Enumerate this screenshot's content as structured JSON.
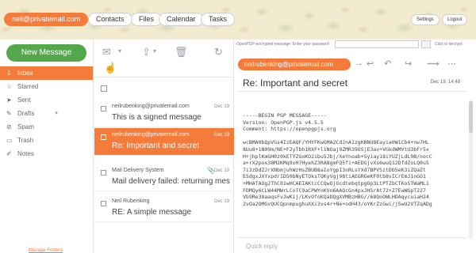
{
  "colors": {
    "accent": "#f47b3a",
    "new_message": "#52a84a"
  },
  "header": {
    "account": "neil@privatemail.com",
    "nav": [
      "Contacts",
      "Files",
      "Calendar",
      "Tasks"
    ],
    "settings": "Settings",
    "logout": "Logout"
  },
  "sidebar": {
    "new_message": "New Message",
    "folders": [
      {
        "label": "Inbox",
        "icon": "inbox-icon"
      },
      {
        "label": "Starred",
        "icon": "star-icon"
      },
      {
        "label": "Sent",
        "icon": "sent-icon"
      },
      {
        "label": "Drafts",
        "icon": "drafts-icon"
      },
      {
        "label": "Spam",
        "icon": "spam-icon"
      },
      {
        "label": "Trash",
        "icon": "trash-icon"
      },
      {
        "label": "Notes",
        "icon": "notes-icon"
      }
    ],
    "manage_folders": "Manage Folders"
  },
  "messages": [
    {
      "from": "neilrubenking@privatemail.com",
      "subject": "This is a signed message",
      "date": "Dec 19"
    },
    {
      "from": "neilrubenking@privatemail.com",
      "subject": "Re: Important and secret",
      "date": "Dec 19"
    },
    {
      "from": "Mail Delivery System",
      "subject": "Mail delivery failed: returning mes",
      "date": "Dec 19"
    },
    {
      "from": "Neil Rubenking",
      "subject": "RE: A simple message",
      "date": "Dec 19"
    }
  ],
  "reader": {
    "pgp_prompt": "OpenPGP-encrypted message: Enter your password",
    "pgp_placeholder": "",
    "pgp_decrypt": "Click to decrypt.",
    "sender": "neilrubenking@privatemail.com",
    "subject": "Re: Important and secret",
    "date": "Dec 19, 14:48",
    "body": "-----BEGIN PGP MESSAGE-----\nVersion: OpenPGP.js v4.5.5\nComment: https://openpgpjs.org\n\nwcBMA0bQpVGs4IzEAQF/YHYFKwGMA2CdJnA1zgKBNU8Eayia0W1Cb4+nw7HL\n8Uu8+1N09m/NE+F2yTbh1RXF+l1NOaj9ZMR39OSjE3av+VGkdWMVtU3bFr5x\nH+jhplKmGH0z0kETYZGoKO2ibu5Jbj/XeYnoab+Syiay18iYUZjLdL9B/nocC\na+rX2pox38M2KMq9xH7HyehZ3RA8gmFQ5fi+AEDGjvXs6wuQ12DfdZoLQ0u5\n7i3zDdZJrXNbmjuhWzHsZBUB8aIoYgpI3nRLsYXd7BPV5ztDb5eK3iZQaZt\nE5dgxJXYxpdrID50bNyETOksTQKyVgj98tiAEGRGeKF0tb8vICrEmJ1nGO1\n+MHATAOg2ThC01wHCAEIAKtcCCQwOjOcdtebqtpgOp3LtPTZbCTKoSTWaML1\nFDMQy6CLW44MWrLCoTC9aCPWYnKVn6AAQcGn4pxJHSrAt72+Z7EwWGpT227\nVb9Re38aaqsFvJwKij/LKvOfoKQaDQgXVMBzHBG//68QoOWLHDAqycuiaH24\n2vOa2OMGvQUCQpnmpughuXXi3vs4r+Ne+odH43/oYKrZzGwi/j5wU2VTZqADg"
  },
  "quick_reply": "Quick reply"
}
